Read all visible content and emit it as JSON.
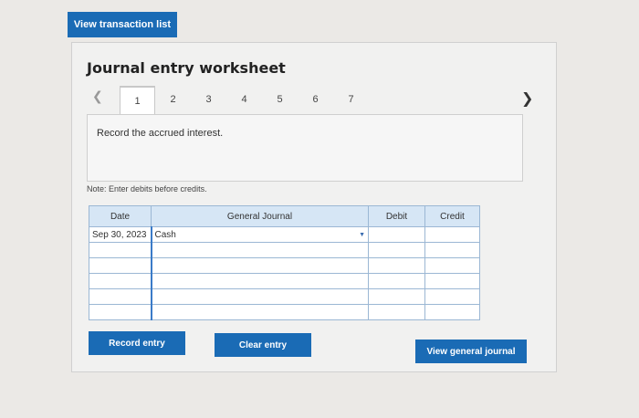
{
  "header": {
    "view_transactions_label": "View transaction list"
  },
  "worksheet": {
    "title": "Journal entry worksheet",
    "prev_icon": "chevron-left",
    "next_icon": "chevron-right",
    "tabs": [
      "1",
      "2",
      "3",
      "4",
      "5",
      "6",
      "7"
    ],
    "active_tab": "1",
    "instruction": "Record the accrued interest.",
    "note": "Note: Enter debits before credits."
  },
  "journal": {
    "headers": {
      "date": "Date",
      "account": "General Journal",
      "debit": "Debit",
      "credit": "Credit"
    },
    "rows": [
      {
        "date": "Sep 30, 2023",
        "account": "Cash",
        "debit": "",
        "credit": ""
      },
      {
        "date": "",
        "account": "",
        "debit": "",
        "credit": ""
      },
      {
        "date": "",
        "account": "",
        "debit": "",
        "credit": ""
      },
      {
        "date": "",
        "account": "",
        "debit": "",
        "credit": ""
      },
      {
        "date": "",
        "account": "",
        "debit": "",
        "credit": ""
      },
      {
        "date": "",
        "account": "",
        "debit": "",
        "credit": ""
      }
    ]
  },
  "buttons": {
    "record": "Record entry",
    "clear": "Clear entry",
    "view_journal": "View general journal"
  },
  "colors": {
    "accent": "#1a6bb5",
    "header_bg": "#d6e6f5"
  }
}
